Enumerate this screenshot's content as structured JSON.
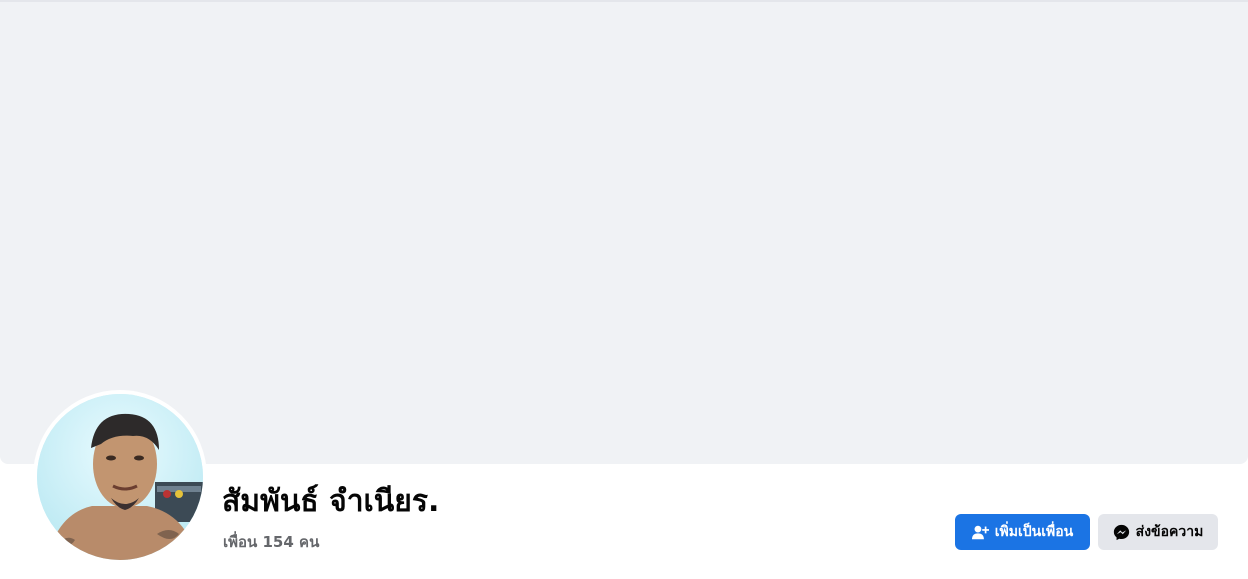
{
  "profile": {
    "name": "สัมพันธ์ จำเนียร.",
    "friends_text": "เพื่อน 154 คน"
  },
  "actions": {
    "add_friend": {
      "label": "เพิ่มเป็นเพื่อน",
      "icon": "add-friend-icon",
      "color": "#1b74e4"
    },
    "message": {
      "label": "ส่งข้อความ",
      "icon": "messenger-icon",
      "color": "#e4e6eb"
    }
  },
  "cover": {
    "color": "#f0f2f5"
  }
}
